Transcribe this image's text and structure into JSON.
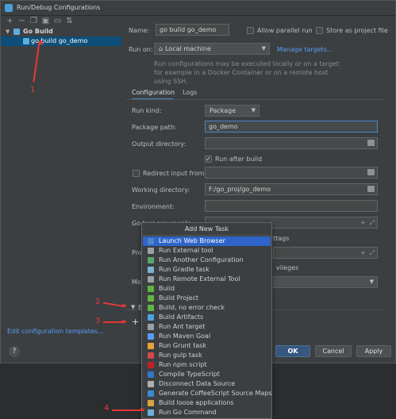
{
  "window": {
    "title": "Run/Debug Configurations"
  },
  "toolbar": {
    "icons": [
      "add-icon",
      "remove-icon",
      "copy-icon",
      "save-icon",
      "move-up-icon",
      "sort-icon"
    ]
  },
  "tree": {
    "group_label": "Go Build",
    "item_label": "go build go_demo"
  },
  "edit_templates": "Edit configuration templates...",
  "form": {
    "name_label": "Name:",
    "name_value": "go build go_demo",
    "allow_parallel": "Allow parallel run",
    "store_as_project": "Store as project file",
    "run_on_label": "Run on:",
    "run_on_value": "Local machine",
    "manage_targets": "Manage targets...",
    "hint": "Run configurations may be executed locally or on a target: for example in a Docker Container or on a remote host using SSH.",
    "tabs": [
      "Configuration",
      "Logs"
    ],
    "run_kind_label": "Run kind:",
    "run_kind_value": "Package",
    "package_path_label": "Package path:",
    "package_path_value": "go_demo",
    "output_dir_label": "Output directory:",
    "run_after_build": "Run after build",
    "redirect_input": "Redirect input from:",
    "working_dir_label": "Working directory:",
    "working_dir_value": "F:/go_proj/go_demo",
    "environment_label": "Environment:",
    "go_tool_args_label": "Go tool arguments:",
    "partial_tags": "ttags",
    "partial_pro": "Pro",
    "partial_privileges": "vileges",
    "partial_mo": "Mo",
    "before_launch": "B"
  },
  "buttons": {
    "ok": "OK",
    "cancel": "Cancel",
    "apply": "Apply",
    "help": "?"
  },
  "add_task_menu": {
    "header": "Add New Task",
    "items": [
      {
        "label": "Launch Web Browser",
        "icon": "globe-icon",
        "color": "#4a88c7"
      },
      {
        "label": "Run External tool",
        "icon": "tool-icon",
        "color": "#9aa0a6"
      },
      {
        "label": "Run Another Configuration",
        "icon": "run-icon",
        "color": "#59a869"
      },
      {
        "label": "Run Gradle task",
        "icon": "gradle-icon",
        "color": "#7fb2d0"
      },
      {
        "label": "Run Remote External Tool",
        "icon": "remote-tool-icon",
        "color": "#9aa0a6"
      },
      {
        "label": "Build",
        "icon": "hammer-icon",
        "color": "#62b543"
      },
      {
        "label": "Build Project",
        "icon": "hammer-icon",
        "color": "#62b543"
      },
      {
        "label": "Build, no error check",
        "icon": "hammer-icon",
        "color": "#62b543"
      },
      {
        "label": "Build Artifacts",
        "icon": "artifact-icon",
        "color": "#4aa3df"
      },
      {
        "label": "Run Ant target",
        "icon": "ant-icon",
        "color": "#9aa0a6"
      },
      {
        "label": "Run Maven Goal",
        "icon": "maven-icon",
        "color": "#589df6"
      },
      {
        "label": "Run Grunt task",
        "icon": "grunt-icon",
        "color": "#e8a33d"
      },
      {
        "label": "Run gulp task",
        "icon": "gulp-icon",
        "color": "#d34a47"
      },
      {
        "label": "Run npm script",
        "icon": "npm-icon",
        "color": "#c12127"
      },
      {
        "label": "Compile TypeScript",
        "icon": "typescript-icon",
        "color": "#3178c6"
      },
      {
        "label": "Disconnect Data Source",
        "icon": "database-icon",
        "color": "#b0b0b0"
      },
      {
        "label": "Generate CoffeeScript Source Maps",
        "icon": "coffeescript-icon",
        "color": "#3b8ccf"
      },
      {
        "label": "Build loose applications",
        "icon": "build-loose-icon",
        "color": "#d9a441"
      },
      {
        "label": "Run Go Command",
        "icon": "go-icon",
        "color": "#6ab0de"
      }
    ]
  },
  "annotations": [
    "1",
    "2",
    "3",
    "4"
  ]
}
